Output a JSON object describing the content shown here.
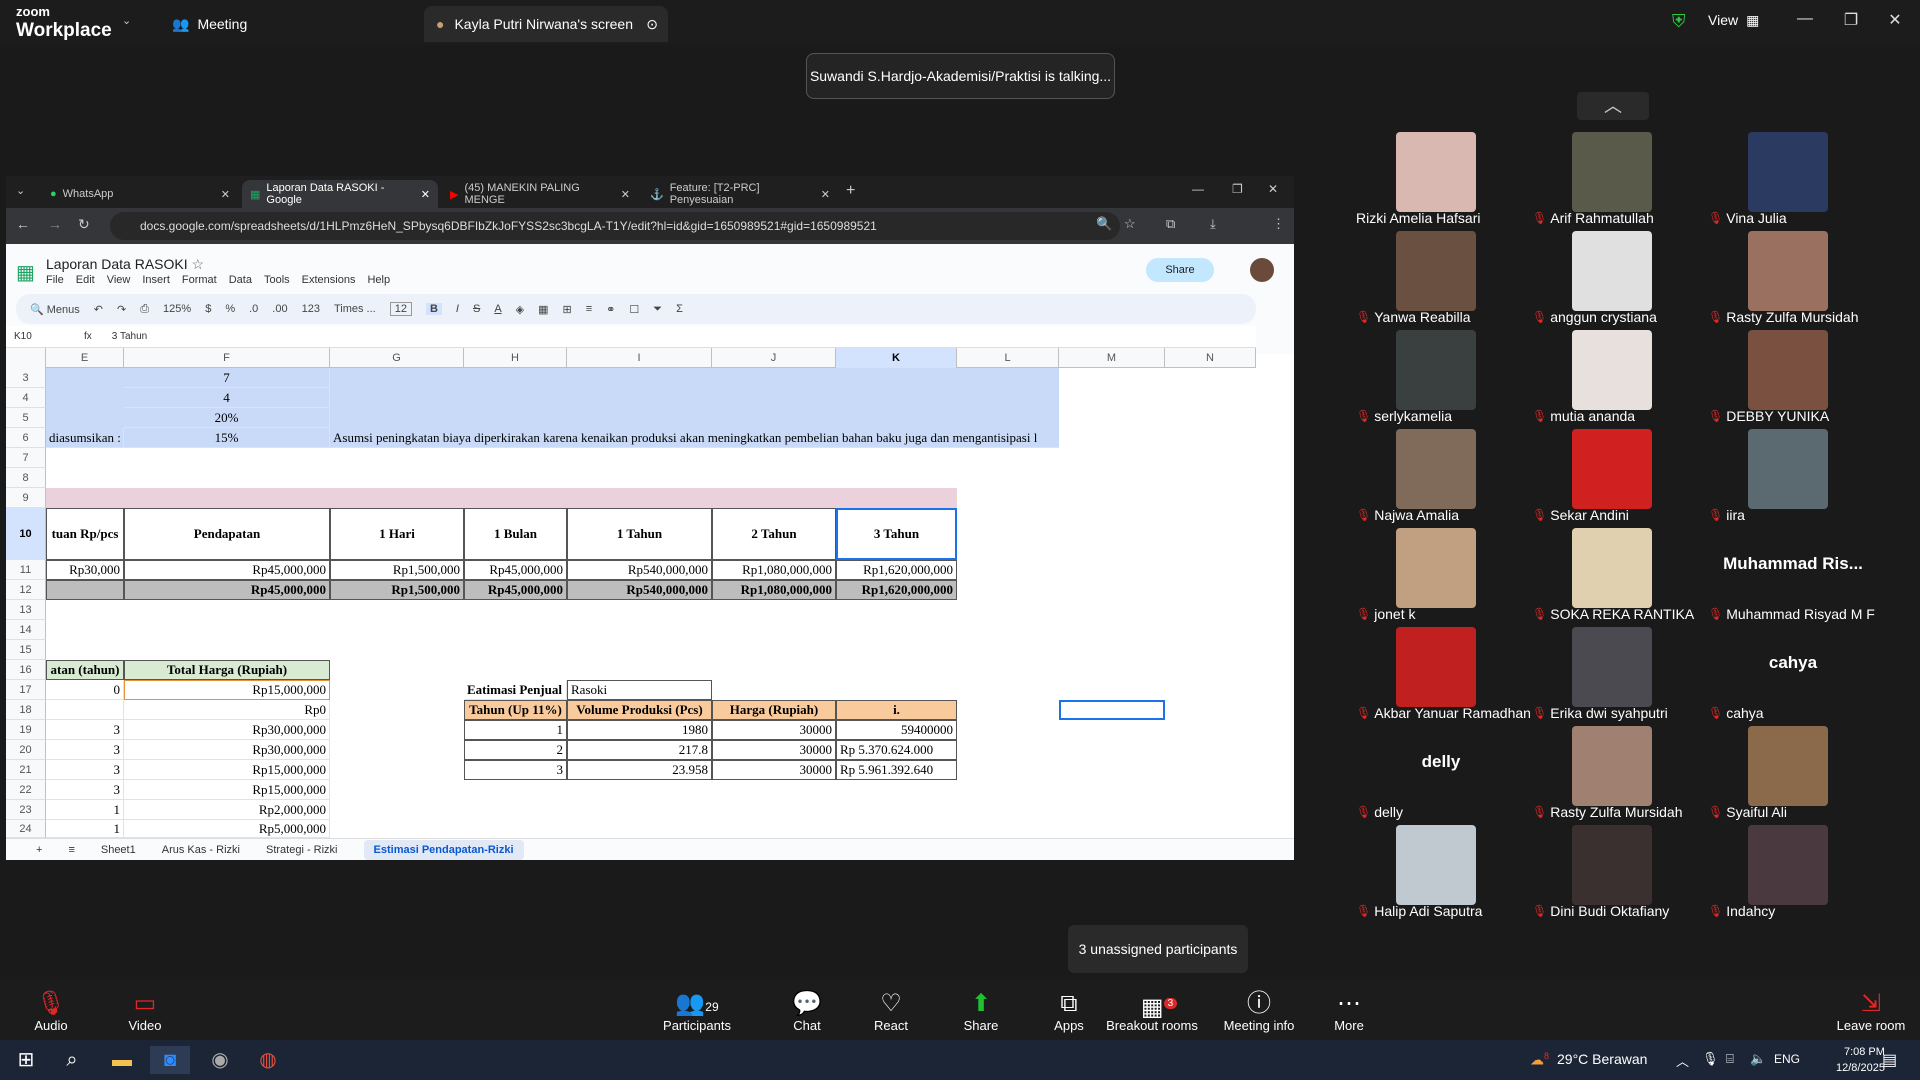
{
  "zoom": {
    "logo_top": "zoom",
    "logo_bottom": "Workplace",
    "meeting_tab": "Meeting",
    "share_tab": "Kayla Putri Nirwana's screen",
    "view_label": "View",
    "talking": "Suwandi S.Hardjo-Akademisi/Praktisi is talking..."
  },
  "chrome": {
    "tabs": [
      "WhatsApp",
      "Laporan Data RASOKI - Google",
      "(45) MANEKIN PALING MENGE",
      "Feature: [T2-PRC] Penyesuaian"
    ],
    "url": "docs.google.com/spreadsheets/d/1HLPmz6HeN_SPbysq6DBFIbZkJoFYSS2sc3bcgLA-T1Y/edit?hl=id&gid=1650989521#gid=1650989521"
  },
  "sheet": {
    "title": "Laporan Data RASOKI",
    "menus": [
      "File",
      "Edit",
      "View",
      "Insert",
      "Format",
      "Data",
      "Tools",
      "Extensions",
      "Help"
    ],
    "toolbar": {
      "menus": "Menus",
      "zoom": "125%",
      "currency": "$",
      "percent": "%",
      "dec1": ".0",
      "dec2": ".00",
      "num": "123",
      "font": "Times ...",
      "size": "12",
      "bold": "B",
      "italic": "I",
      "strike": "S",
      "text_color": "A",
      "sum": "Σ"
    },
    "share": "Share",
    "cell_ref": "K10",
    "formula": "3 Tahun",
    "columns": [
      "E",
      "F",
      "G",
      "H",
      "I",
      "J",
      "K",
      "L",
      "M",
      "N"
    ],
    "rows": [
      "3",
      "4",
      "5",
      "6",
      "7",
      "8",
      "9",
      "10",
      "11",
      "12",
      "13",
      "14",
      "15",
      "16",
      "17",
      "18",
      "19",
      "20",
      "21",
      "22",
      "23",
      "24"
    ],
    "f3": "7",
    "f4": "4",
    "f5": "20%",
    "f6": "15%",
    "e6": "diasumsikan :",
    "g6": "Asumsi peningkatan biaya diperkirakan karena kenaikan produksi akan meningkatkan pembelian bahan baku juga dan mengantisipasi l",
    "h10": [
      "tuan Rp/pcs",
      "Pendapatan",
      "1 Hari",
      "1 Bulan",
      "1 Tahun",
      "2 Tahun",
      "3 Tahun"
    ],
    "r11": [
      "Rp30,000",
      "Rp45,000,000",
      "Rp1,500,000",
      "Rp45,000,000",
      "Rp540,000,000",
      "Rp1,080,000,000",
      "Rp1,620,000,000"
    ],
    "r12": [
      "Rp45,000,000",
      "Rp1,500,000",
      "Rp45,000,000",
      "Rp540,000,000",
      "Rp1,080,000,000",
      "Rp1,620,000,000"
    ],
    "e16": "atan (tahun)",
    "f16": "Total Harga (Rupiah)",
    "e_vals": [
      "0",
      "",
      "3",
      "3",
      "3",
      "3",
      "1",
      "1"
    ],
    "f_vals": [
      "Rp15,000,000",
      "Rp0",
      "Rp30,000,000",
      "Rp30,000,000",
      "Rp15,000,000",
      "Rp15,000,000",
      "Rp2,000,000",
      "Rp5,000,000"
    ],
    "est_title": "Eatimasi Penjual",
    "est_name": "Rasoki",
    "est_headers": [
      "Tahun (Up 11%)",
      "Volume Produksi (Pcs)",
      "Harga (Rupiah)",
      "i."
    ],
    "est_rows": [
      [
        "1",
        "1980",
        "30000",
        "59400000"
      ],
      [
        "2",
        "217.8",
        "30000",
        "Rp 5.370.624.000"
      ],
      [
        "3",
        "23.958",
        "30000",
        "Rp 5.961.392.640"
      ]
    ],
    "sheets": [
      "Sheet1",
      "Arus Kas - Rizki",
      "Strategi - Rizki",
      "Estimasi Pendapatan-Rizki"
    ]
  },
  "participants": [
    {
      "name": "Rizki Amelia Hafsari",
      "muted": false,
      "color": "#d8b8b0"
    },
    {
      "name": "Arif Rahmatullah",
      "muted": true,
      "color": "#5a5a4a"
    },
    {
      "name": "Vina Julia",
      "muted": true,
      "color": "#2a3a60"
    },
    {
      "name": "Yanwa Reabilla",
      "muted": true,
      "color": "#6a5040"
    },
    {
      "name": "anggun crystiana",
      "muted": true,
      "color": "#e0e0e0"
    },
    {
      "name": "Rasty Zulfa Mursidah",
      "muted": true,
      "color": "#9a7060"
    },
    {
      "name": "serlykamelia",
      "muted": true,
      "color": "#3a4040"
    },
    {
      "name": "mutia ananda",
      "muted": true,
      "color": "#e8e0dc"
    },
    {
      "name": "DEBBY YUNIKA",
      "muted": true,
      "color": "#7a5040"
    },
    {
      "name": "Najwa Amalia",
      "muted": true,
      "color": "#806a5a"
    },
    {
      "name": "Sekar Andini",
      "muted": true,
      "color": "#d02020"
    },
    {
      "name": "iira",
      "muted": true,
      "color": "#5a6a70"
    },
    {
      "name": "jonet k",
      "muted": true,
      "color": "#c0a080"
    },
    {
      "name": "SOKA REKA RANTIKA",
      "muted": true,
      "color": "#e0d0b0"
    },
    {
      "name": "Muhammad Risyad M F",
      "muted": true,
      "big": "Muhammad  Ris..."
    },
    {
      "name": "Akbar Yanuar Ramadhan",
      "muted": true,
      "color": "#c02020"
    },
    {
      "name": "Erika dwi syahputri",
      "muted": true,
      "color": "#4a4a50"
    },
    {
      "name": "cahya",
      "muted": true,
      "big": "cahya"
    },
    {
      "name": "delly",
      "muted": true,
      "big": "delly"
    },
    {
      "name": "Rasty Zulfa Mursidah",
      "muted": true,
      "color": "#a08070"
    },
    {
      "name": "Syaiful Ali",
      "muted": true,
      "color": "#8a6a4a"
    },
    {
      "name": "Halip Adi Saputra",
      "muted": true,
      "color": "#c0c8d0"
    },
    {
      "name": "Dini Budi Oktafiany",
      "muted": true,
      "color": "#3a3030"
    },
    {
      "name": "Indahcy",
      "muted": true,
      "color": "#4a3a40"
    }
  ],
  "bottom": {
    "audio": "Audio",
    "video": "Video",
    "participants": "Participants",
    "participants_count": "29",
    "chat": "Chat",
    "react": "React",
    "share": "Share",
    "apps": "Apps",
    "breakout": "Breakout rooms",
    "breakout_count": "3",
    "info": "Meeting info",
    "more": "More",
    "leave": "Leave room",
    "unassigned": "3 unassigned participants"
  },
  "taskbar": {
    "weather": "29°C  Berawan",
    "weather_badge": "8",
    "lang": "ENG",
    "time": "7:08 PM",
    "date": "12/8/2025"
  }
}
